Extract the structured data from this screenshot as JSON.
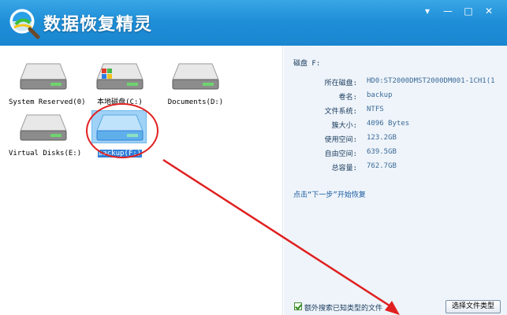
{
  "app": {
    "title": "数据恢复精灵",
    "controls": {
      "menu": "▾",
      "minimize": "—",
      "maximize": "□",
      "close": "✕"
    }
  },
  "drives": [
    {
      "label": "System Reserved(0)",
      "icon": "hdd-icon",
      "selected": false
    },
    {
      "label": "本地磁盘(C:)",
      "icon": "windows-hdd-icon",
      "selected": false
    },
    {
      "label": "Documents(D:)",
      "icon": "hdd-icon",
      "selected": false
    },
    {
      "label": "Virtual Disks(E:)",
      "icon": "hdd-icon",
      "selected": false
    },
    {
      "label": "backup(F:)",
      "icon": "hdd-icon",
      "selected": true
    }
  ],
  "details": {
    "heading": "磁盘 F:",
    "rows": [
      {
        "key": "所在磁盘:",
        "value": "HD0:ST2000DMST2000DM001-1CH1(1"
      },
      {
        "key": "卷名:",
        "value": "backup"
      },
      {
        "key": "文件系统:",
        "value": "NTFS"
      },
      {
        "key": "簇大小:",
        "value": "4096 Bytes"
      },
      {
        "key": "使用空间:",
        "value": "123.2GB"
      },
      {
        "key": "自由空间:",
        "value": "639.5GB"
      },
      {
        "key": "总容量:",
        "value": "762.7GB"
      }
    ],
    "hint": "点击“下一步”开始恢复"
  },
  "footer": {
    "checkbox_label": "额外搜索已知类型的文件",
    "checkbox_checked": true,
    "select_button": "选择文件类型"
  },
  "colors": {
    "titlebar": "#1f8fd8",
    "panel": "#eef4fa",
    "selection": "#2f7fd8",
    "annotation": "#e02020"
  }
}
